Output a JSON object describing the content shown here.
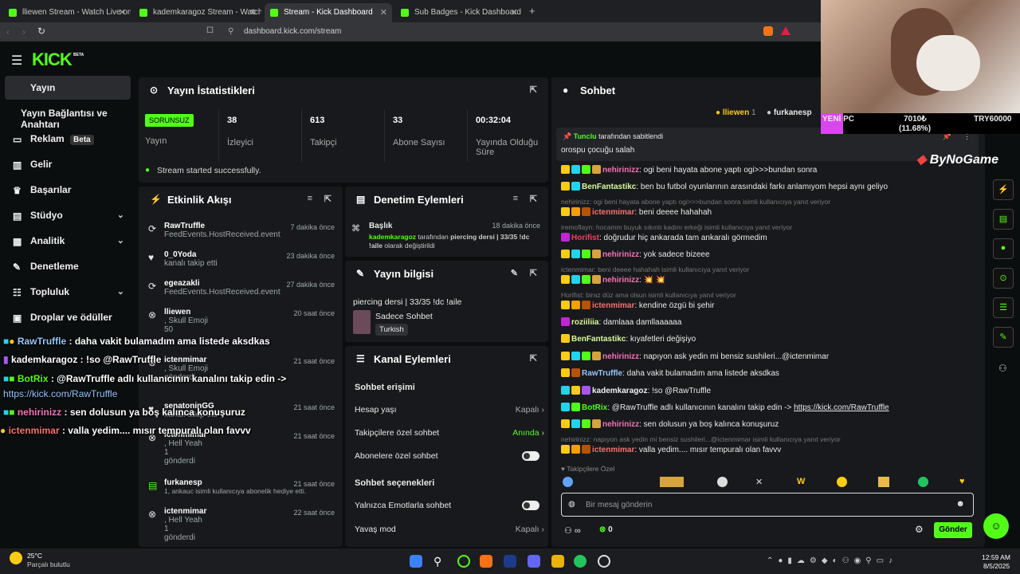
{
  "browser": {
    "tabs": [
      "lliewen Stream - Watch Live on K",
      "kademkaragoz Stream - Watch Live o",
      "Stream - Kick Dashboard",
      "Sub Badges - Kick Dashboard"
    ],
    "url": "dashboard.kick.com/stream",
    "new_tab": "+"
  },
  "logo": {
    "text": "KICK",
    "beta": "BETA"
  },
  "sidebar": {
    "items": [
      {
        "label": "Yayın"
      },
      {
        "label": "Yayın Bağlantısı ve Anahtarı"
      },
      {
        "label": "Reklam",
        "badge": "Beta"
      },
      {
        "label": "Gelir"
      },
      {
        "label": "Başarılar"
      },
      {
        "label": "Stüdyo"
      },
      {
        "label": "Analitik"
      },
      {
        "label": "Denetleme"
      },
      {
        "label": "Topluluk"
      },
      {
        "label": "Droplar ve ödüller"
      }
    ]
  },
  "stats": {
    "title": "Yayın İstatistikleri",
    "status_badge": "SORUNSUZ",
    "status_label": "Yayın",
    "viewers": "38",
    "viewers_label": "İzleyici",
    "followers": "613",
    "followers_label": "Takipçi",
    "subs": "33",
    "subs_label": "Abone Sayısı",
    "uptime": "00:32:04",
    "uptime_label": "Yayında Olduğu Süre",
    "success": "Stream started successfully."
  },
  "activity": {
    "title": "Etkinlik Akışı",
    "events": [
      {
        "name": "RawTruffle",
        "sub": "FeedEvents.HostReceived.event",
        "time": "7 dakika önce"
      },
      {
        "name": "0_0Yoda",
        "sub": "kanalı takip etti",
        "time": "23 dakika önce"
      },
      {
        "name": "egeazakli",
        "sub": "FeedEvents.HostReceived.event",
        "time": "27 dakika önce"
      },
      {
        "name": "lliewen",
        "sub": ", Skull Emoji",
        "extra": "50",
        "time": "20 saat önce"
      },
      {
        "name": "ictenmimar",
        "sub": ", Skull Emoji",
        "extra": "gönderdi",
        "time": "21 saat önce"
      },
      {
        "name": "senatoninGG",
        "sub": "kanalı takip etti",
        "time": "21 saat önce"
      },
      {
        "name": "ictenmimar",
        "sub": ", Hell Yeah",
        "extra": "1",
        "extra2": "gönderdi",
        "time": "21 saat önce"
      },
      {
        "name": "furkanesp",
        "sub": "1, ankauc isimli kullanıcıya abonelik hediye etti.",
        "time": "21 saat önce"
      },
      {
        "name": "ictenmimar",
        "sub": ", Hell Yeah",
        "extra": "1",
        "extra2": "gönderdi",
        "time": "22 saat önce"
      }
    ]
  },
  "moderation": {
    "title": "Denetim Eylemleri",
    "item_title": "Başlık",
    "item_time": "18 dakika önce",
    "item_user": "kademkaragoz",
    "item_text1": " tarafından ",
    "item_bold": "piercing dersi | 33/35 !dc !aile",
    "item_text2": " olarak değiştirildi"
  },
  "stream_info": {
    "title": "Yayın bilgisi",
    "stream_title": "piercing dersi | 33/35 !dc !aile",
    "category": "Sadece Sohbet",
    "tag": "Turkish"
  },
  "channel_actions": {
    "title": "Kanal Eylemleri",
    "chat_access": "Sohbet erişimi",
    "account_age": "Hesap yaşı",
    "account_age_val": "Kapalı",
    "followers_only": "Takipçilere özel sohbet",
    "followers_only_val": "Anında",
    "subs_only": "Abonelere özel sohbet",
    "chat_options": "Sohbet seçenekleri",
    "emote_only": "Yalnızca Emotlarla sohbet",
    "slow_mode": "Yavaş mod",
    "slow_mode_val": "Kapalı"
  },
  "chat": {
    "title": "Sohbet",
    "top_users": [
      {
        "name": "lliewen",
        "count": "1"
      },
      {
        "name": "furkanesp",
        "count": ""
      }
    ],
    "pinned_by": "Tunclu",
    "pinned_label": "tarafından sabitlendi",
    "pinned_msg": "orospu çocuğu salah",
    "messages": [
      {
        "reply": "",
        "user": "nehirinizz",
        "color": "#f472b6",
        "text": ": ogi beni hayata abone yaptı ogi>>>bundan sonra"
      },
      {
        "reply": "",
        "user": "BenFantastikc",
        "color": "#d9f99d",
        "text": ": ben bu futbol oyunlarının arasındaki farkı anlamıyom hepsi aynı geliyo"
      },
      {
        "reply": "nehirinizz: ogi beni hayata abone yaptı ogi>>>bundan sonra isimli kullanıcıya yanıt veriyor",
        "user": "ictenmimar",
        "color": "#f87171",
        "text": ": beni deeee hahahah"
      },
      {
        "reply": "iremoflayn: hocamm buyuk sıkıntı kadını erkeği isimli kullanıcıya yanıt veriyor",
        "user": "Horifist",
        "color": "#f43f5e",
        "text": ": doğrudur hiç ankarada tam ankaralı görmedim"
      },
      {
        "reply": "",
        "user": "nehirinizz",
        "color": "#f472b6",
        "text": ": yok sadece bizeee"
      },
      {
        "reply": "ictenmimar: beni deeee hahahah isimli kullanıcıya yanıt veriyor",
        "user": "nehirinizz",
        "color": "#f472b6",
        "text": ": 💥 💥"
      },
      {
        "reply": "Horifist: biraz düz ama olsun isimli kullanıcıya yanıt veriyor",
        "user": "ictenmimar",
        "color": "#f87171",
        "text": ": kendine özgü bi şehir"
      },
      {
        "reply": "",
        "user": "roziiliia",
        "color": "#d9f99d",
        "text": ": damlaaa damllaaaaaa"
      },
      {
        "reply": "",
        "user": "BenFantastikc",
        "color": "#d9f99d",
        "text": ": kıyafetleri değişiyo"
      },
      {
        "reply": "",
        "user": "nehirinizz",
        "color": "#f472b6",
        "text": ": napıyon ask yedin mi bensiz sushileri...@ictenmimar"
      },
      {
        "reply": "",
        "user": "RawTruffle",
        "color": "#93c5fd",
        "text": ": daha vakit bulamadım ama listede aksdkas"
      },
      {
        "reply": "",
        "user": "kademkaragoz",
        "color": "#f0f0f0",
        "text": ": !so @RawTruffle"
      },
      {
        "reply": "",
        "user": "BotRix",
        "color": "#53fc18",
        "text": ": @RawTruffle adlı kullanıcının kanalını takip edin -> ",
        "link": "https://kick.com/RawTruffle"
      },
      {
        "reply": "",
        "user": "nehirinizz",
        "color": "#f472b6",
        "text": ": sen dolusun ya boş kalınca konuşuruz"
      },
      {
        "reply": "nehirinizz: napıyon ask yedin mi bensiz sushileri...@ictenmimar isimli kullanıcıya yanıt veriyor",
        "user": "ictenmimar",
        "color": "#f87171",
        "text": ": valla yedim.... mısır tempuralı olan favvv"
      }
    ],
    "followers_only_note": "Takipçilere Özel",
    "input_placeholder": "Bir mesaj gönderin",
    "points": "0",
    "send": "Gönder"
  },
  "overlay": {
    "lines": [
      {
        "user": "RawTruffle",
        "text": " : daha vakit bulamadım ama listede aksdkas"
      },
      {
        "user": "kademkaragoz",
        "text": " : !so @RawTruffle"
      },
      {
        "user": "BotRix",
        "text": " : @RawTruffle adlı kullanıcının kanalını takip edin ->"
      },
      {
        "user": "",
        "text": "https://kick.com/RawTruffle"
      },
      {
        "user": "nehirinizz",
        "text": " : sen dolusun ya boş kalınca konuşuruz"
      },
      {
        "user": "ictenmimar",
        "text": " : valla yedim.... mısır tempuralı olan favvv"
      }
    ],
    "goal_label": "YENİ PC",
    "goal_amount": "7010₺",
    "goal_percent": "(11.68%)",
    "goal_target": "TRY60000",
    "sponsor": "ByNoGame"
  },
  "taskbar": {
    "weather_temp": "25°C",
    "weather_text": "Parçalı bulutlu",
    "time": "12:59 AM",
    "date": "8/5/2025"
  }
}
